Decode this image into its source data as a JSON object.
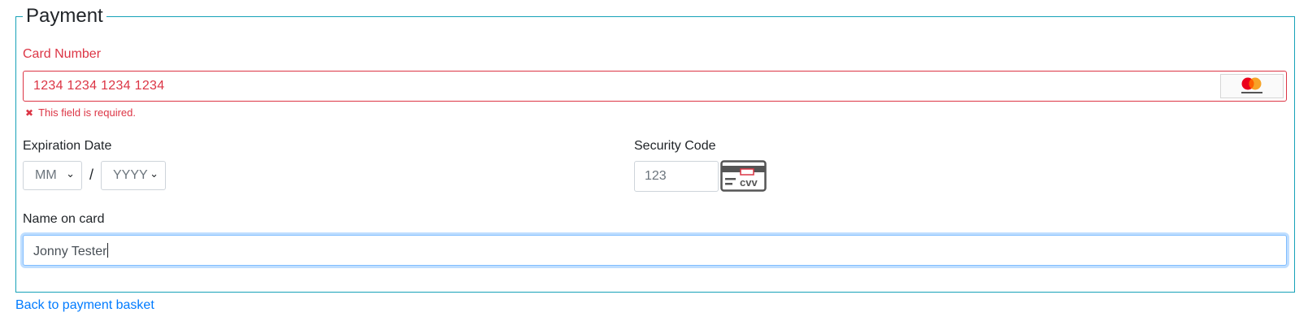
{
  "payment": {
    "legend": "Payment",
    "card_number": {
      "label": "Card Number",
      "value": "1234 1234 1234 1234",
      "brand_icon": "mastercard-logo",
      "error": "This field is required.",
      "error_icon": "x-icon"
    },
    "expiration": {
      "label": "Expiration Date",
      "month_selected": "MM",
      "separator": "/",
      "year_selected": "YYYY"
    },
    "security_code": {
      "label": "Security Code",
      "placeholder": "123",
      "icon_text": "cvv"
    },
    "name": {
      "label": "Name on card",
      "value": "Jonny Tester"
    }
  },
  "footer": {
    "back_link": "Back to payment basket"
  },
  "colors": {
    "fieldset_border": "#17a2b8",
    "error": "#dc3545",
    "link": "#007bff",
    "focus": "#80bdff"
  }
}
